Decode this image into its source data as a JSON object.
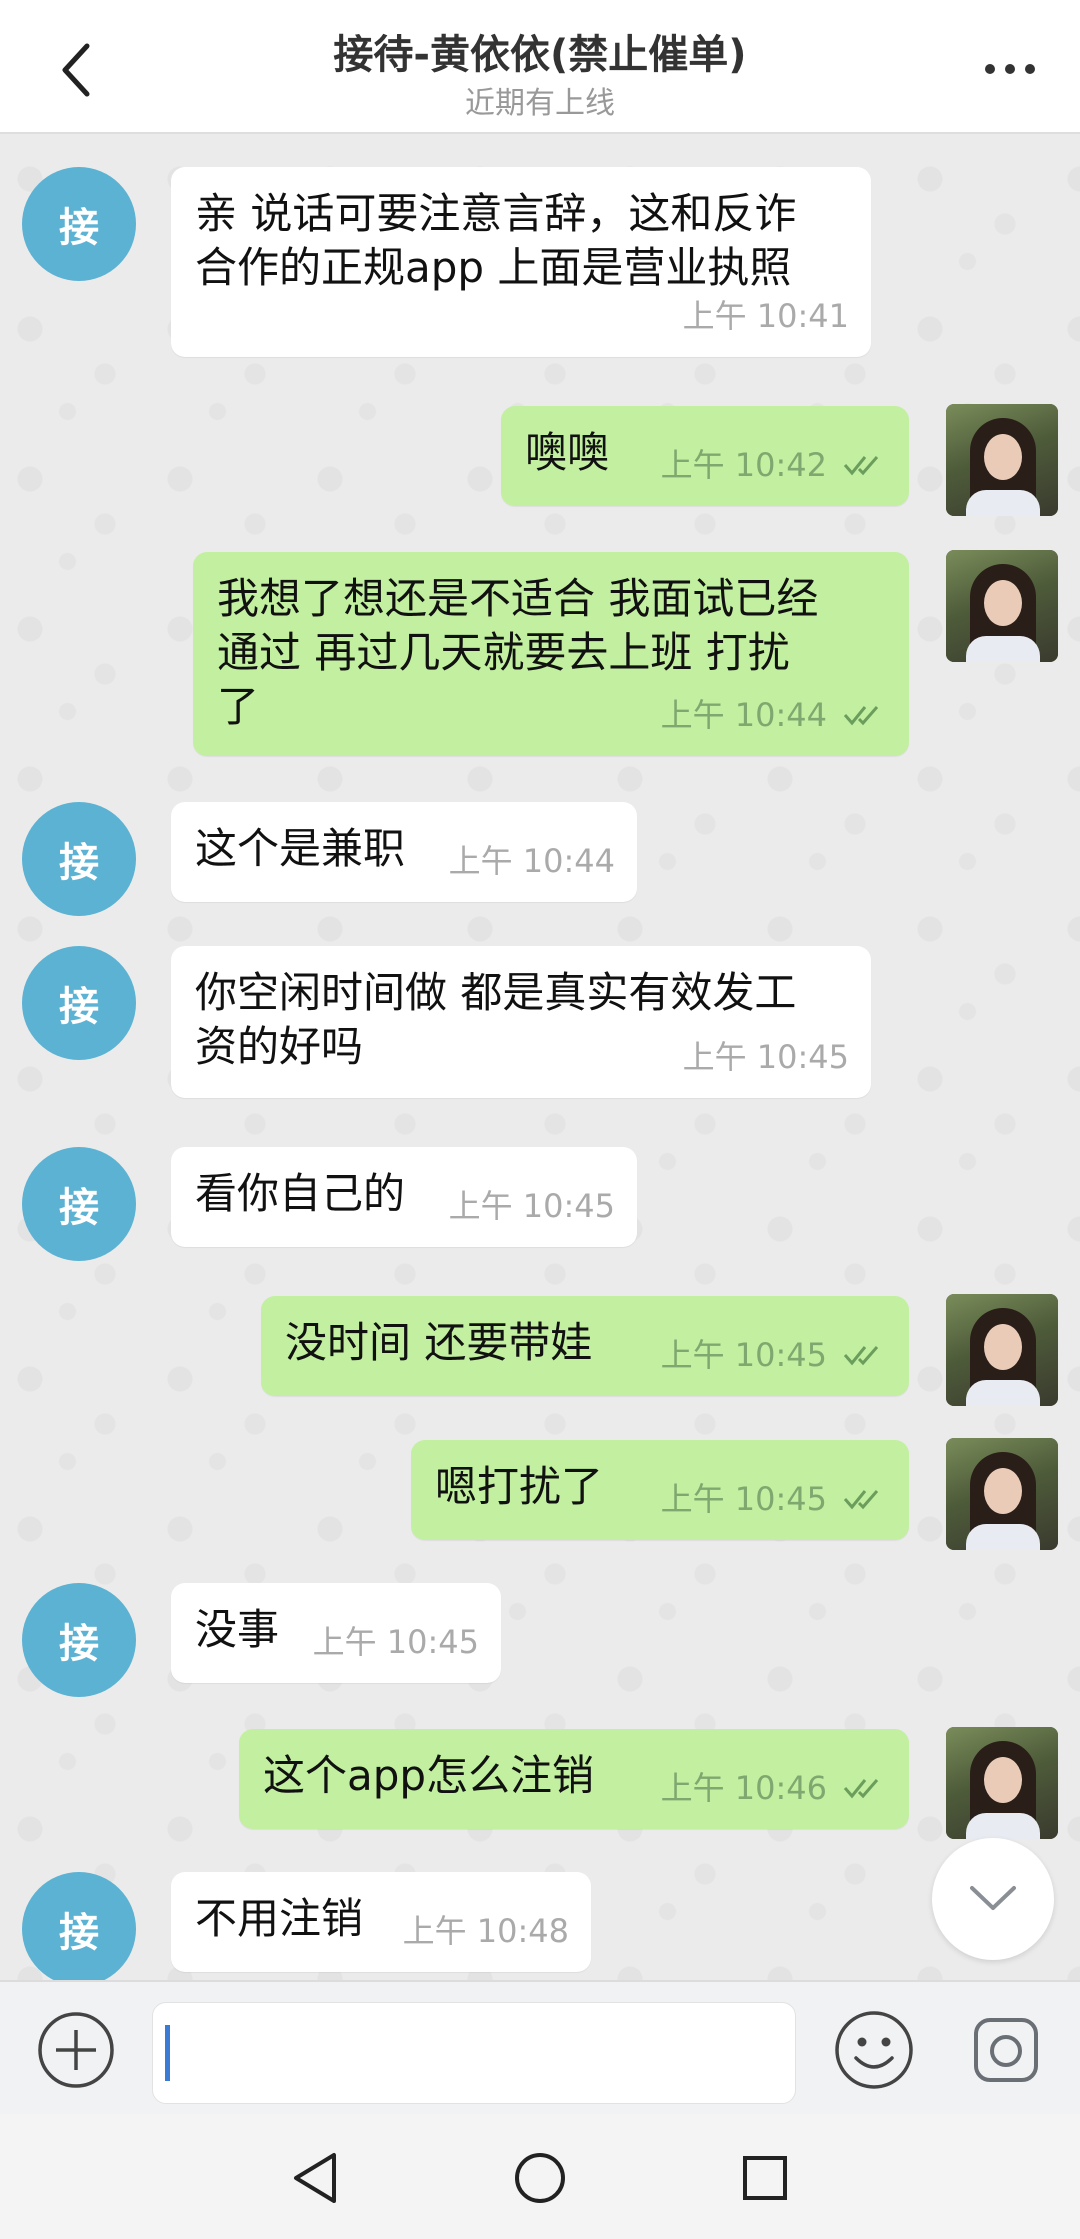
{
  "header": {
    "title": "接待-黄依依(禁止催单)",
    "status": "近期有上线"
  },
  "incoming_avatar_label": "接",
  "messages": [
    {
      "dir": "in",
      "text": "亲 说话可要注意言辞，这和反诈\n合作的正规app 上面是营业执照",
      "time": "上午  10:41"
    },
    {
      "dir": "out",
      "text": "噢噢",
      "time": "上午  10:42"
    },
    {
      "dir": "out",
      "text": "我想了想还是不适合 我面试已经\n通过 再过几天就要去上班 打扰\n了",
      "time": "上午  10:44"
    },
    {
      "dir": "in",
      "text": "这个是兼职",
      "time": "上午  10:44"
    },
    {
      "dir": "in",
      "text": "你空闲时间做 都是真实有效发工\n资的好吗",
      "time": "上午  10:45"
    },
    {
      "dir": "in",
      "text": "看你自己的",
      "time": "上午  10:45"
    },
    {
      "dir": "out",
      "text": "没时间 还要带娃",
      "time": "上午  10:45"
    },
    {
      "dir": "out",
      "text": "嗯打扰了",
      "time": "上午  10:45"
    },
    {
      "dir": "in",
      "text": "没事",
      "time": "上午  10:45"
    },
    {
      "dir": "out",
      "text": "这个app怎么注销",
      "time": "上午  10:46"
    },
    {
      "dir": "in",
      "text": "不用注销",
      "time": "上午  10:48"
    }
  ],
  "input": {
    "value": ""
  },
  "colors": {
    "incoming_bubble": "#ffffff",
    "outgoing_bubble": "#c2f0a0",
    "avatar": "#5bb2d3",
    "caret": "#3d7ad6"
  },
  "icons": [
    "back-arrow-icon",
    "more-dots-icon",
    "chevron-down-icon",
    "add-icon",
    "emoji-icon",
    "camera-icon",
    "nav-back-icon",
    "nav-home-icon",
    "nav-recents-icon",
    "read-ticks-icon"
  ]
}
